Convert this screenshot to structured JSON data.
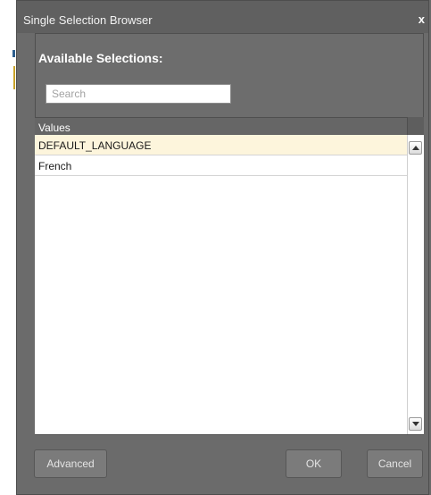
{
  "dialog": {
    "title": "Single Selection Browser",
    "close_glyph": "x",
    "heading": "Available Selections:"
  },
  "search": {
    "placeholder": "Search",
    "value": ""
  },
  "table": {
    "column_header": "Values",
    "rows": [
      {
        "label": "DEFAULT_LANGUAGE",
        "selected": true
      },
      {
        "label": "French",
        "selected": false
      }
    ]
  },
  "buttons": {
    "advanced": "Advanced",
    "ok": "OK",
    "cancel": "Cancel"
  },
  "icons": {
    "close": "close-icon",
    "scroll_up": "chevron-up-icon",
    "scroll_down": "chevron-down-icon"
  },
  "colors": {
    "dialog_bg": "#6b6b6b",
    "selected_row": "#fdf5dc",
    "heading_text": "#ffffff"
  }
}
